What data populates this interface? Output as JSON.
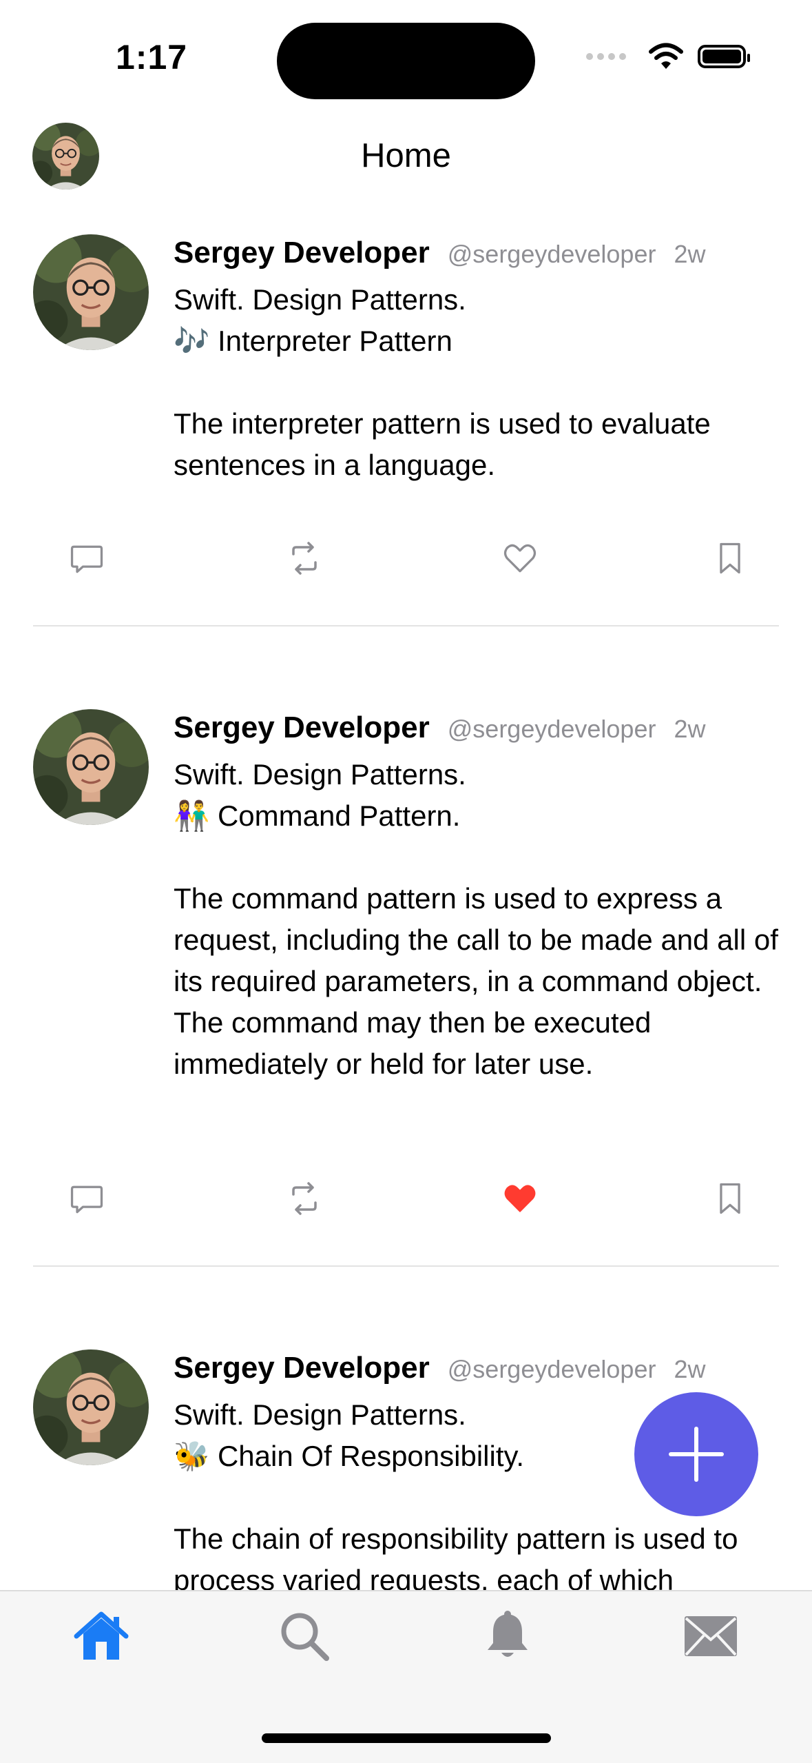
{
  "status_bar": {
    "time": "1:17"
  },
  "header": {
    "title": "Home"
  },
  "posts": [
    {
      "author": "Sergey Developer",
      "handle": "@sergeydeveloper",
      "time": "2w",
      "body": "Swift. Design Patterns.\n🎶 Interpreter Pattern\n\nThe interpreter pattern is used to evaluate sentences in a language.",
      "liked": false
    },
    {
      "author": "Sergey Developer",
      "handle": "@sergeydeveloper",
      "time": "2w",
      "body": "Swift. Design Patterns.\n👫 Command Pattern.\n\nThe command pattern is used to express a request, including the call to be made and all of its required parameters, in a command object. The command may then be executed immediately or held for later use.",
      "liked": true
    },
    {
      "author": "Sergey Developer",
      "handle": "@sergeydeveloper",
      "time": "2w",
      "body": "Swift. Design Patterns.\n🐝 Chain Of Responsibility.\n\nThe chain of responsibility pattern is used to process varied requests, each of which",
      "liked": false
    }
  ],
  "icons": {
    "reply": "speech-bubble-icon",
    "retweet": "retweet-icon",
    "like": "heart-icon",
    "bookmark": "bookmark-icon",
    "compose": "plus-icon",
    "tabs": [
      "home-icon",
      "search-icon",
      "bell-icon",
      "envelope-icon"
    ]
  },
  "colors": {
    "accent": "#1a7cf5",
    "fab": "#5e5ce6",
    "like_active": "#ff3b30",
    "icon_gray": "#8e8e93"
  },
  "tabbar": {
    "active_index": 0
  }
}
